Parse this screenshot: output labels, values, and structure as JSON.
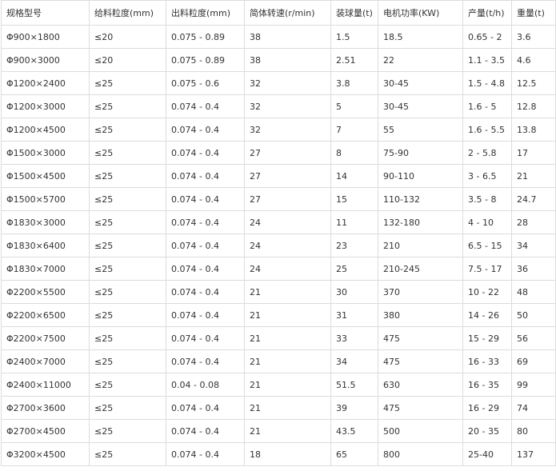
{
  "table": {
    "headers": [
      "规格型号",
      "给料粒度(mm)",
      "出料粒度(mm)",
      "简体转速(r/min)",
      "装球量(t)",
      "电机功率(KW)",
      "产量(t/h)",
      "重量(t)"
    ],
    "rows": [
      [
        "Φ900×1800",
        "≤20",
        "0.075 - 0.89",
        "38",
        "1.5",
        "18.5",
        "0.65 - 2",
        "3.6"
      ],
      [
        "Φ900×3000",
        "≤20",
        "0.075 - 0.89",
        "38",
        "2.51",
        "22",
        "1.1 - 3.5",
        "4.6"
      ],
      [
        "Φ1200×2400",
        "≤25",
        "0.075 - 0.6",
        "32",
        "3.8",
        "30-45",
        "1.5 - 4.8",
        "12.5"
      ],
      [
        "Φ1200×3000",
        "≤25",
        "0.074 - 0.4",
        "32",
        "5",
        "30-45",
        "1.6 - 5",
        "12.8"
      ],
      [
        "Φ1200×4500",
        "≤25",
        "0.074 - 0.4",
        "32",
        "7",
        "55",
        "1.6 - 5.5",
        "13.8"
      ],
      [
        "Φ1500×3000",
        "≤25",
        "0.074 - 0.4",
        "27",
        "8",
        "75-90",
        "2 - 5.8",
        "17"
      ],
      [
        "Φ1500×4500",
        "≤25",
        "0.074 - 0.4",
        "27",
        "14",
        "90-110",
        "3 - 6.5",
        "21"
      ],
      [
        "Φ1500×5700",
        "≤25",
        "0.074 - 0.4",
        "27",
        "15",
        "110-132",
        "3.5 - 8",
        "24.7"
      ],
      [
        "Φ1830×3000",
        "≤25",
        "0.074 - 0.4",
        "24",
        "11",
        "132-180",
        "4 - 10",
        "28"
      ],
      [
        "Φ1830×6400",
        "≤25",
        "0.074 - 0.4",
        "24",
        "23",
        "210",
        "6.5 - 15",
        "34"
      ],
      [
        "Φ1830×7000",
        "≤25",
        "0.074 - 0.4",
        "24",
        "25",
        "210-245",
        "7.5 - 17",
        "36"
      ],
      [
        "Φ2200×5500",
        "≤25",
        "0.074 - 0.4",
        "21",
        "30",
        "370",
        "10 - 22",
        "48"
      ],
      [
        "Φ2200×6500",
        "≤25",
        "0.074 - 0.4",
        "21",
        "31",
        "380",
        "14 - 26",
        "50"
      ],
      [
        "Φ2200×7500",
        "≤25",
        "0.074 - 0.4",
        "21",
        "33",
        "475",
        "15 - 29",
        "56"
      ],
      [
        "Φ2400×7000",
        "≤25",
        "0.074 - 0.4",
        "21",
        "34",
        "475",
        "16 - 33",
        "69"
      ],
      [
        "Φ2400×11000",
        "≤25",
        "0.04 - 0.08",
        "21",
        "51.5",
        "630",
        "16 - 35",
        "99"
      ],
      [
        "Φ2700×3600",
        "≤25",
        "0.074 - 0.4",
        "21",
        "39",
        "475",
        "16 - 29",
        "74"
      ],
      [
        "Φ2700×4500",
        "≤25",
        "0.074 - 0.4",
        "21",
        "43.5",
        "500",
        "20 - 35",
        "80"
      ],
      [
        "Φ3200×4500",
        "≤25",
        "0.074 - 0.4",
        "18",
        "65",
        "800",
        "25-40",
        "137"
      ]
    ]
  }
}
